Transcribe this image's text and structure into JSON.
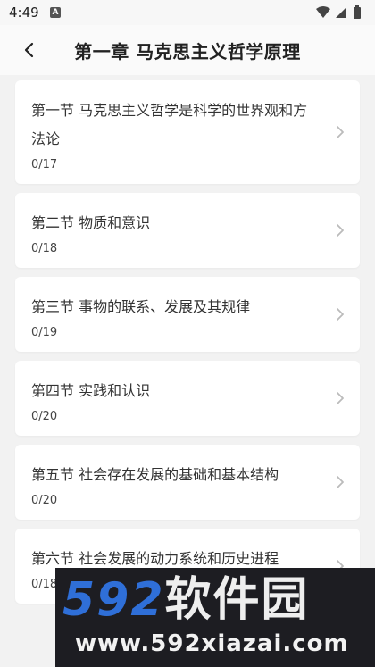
{
  "status_bar": {
    "time": "4:49",
    "notification_icon": "A"
  },
  "header": {
    "title": "第一章 马克思主义哲学原理"
  },
  "sections": [
    {
      "title": "第一节 马克思主义哲学是科学的世界观和方法论",
      "progress": "0/17"
    },
    {
      "title": "第二节 物质和意识",
      "progress": "0/18"
    },
    {
      "title": "第三节 事物的联系、发展及其规律",
      "progress": "0/19"
    },
    {
      "title": "第四节 实践和认识",
      "progress": "0/20"
    },
    {
      "title": "第五节 社会存在发展的基础和基本结构",
      "progress": "0/20"
    },
    {
      "title": "第六节 社会发展的动力系统和历史进程",
      "progress": "0/18"
    }
  ],
  "watermark": {
    "logo_number": "592",
    "logo_text": "软件园",
    "url": "www.592xiazai.com"
  }
}
